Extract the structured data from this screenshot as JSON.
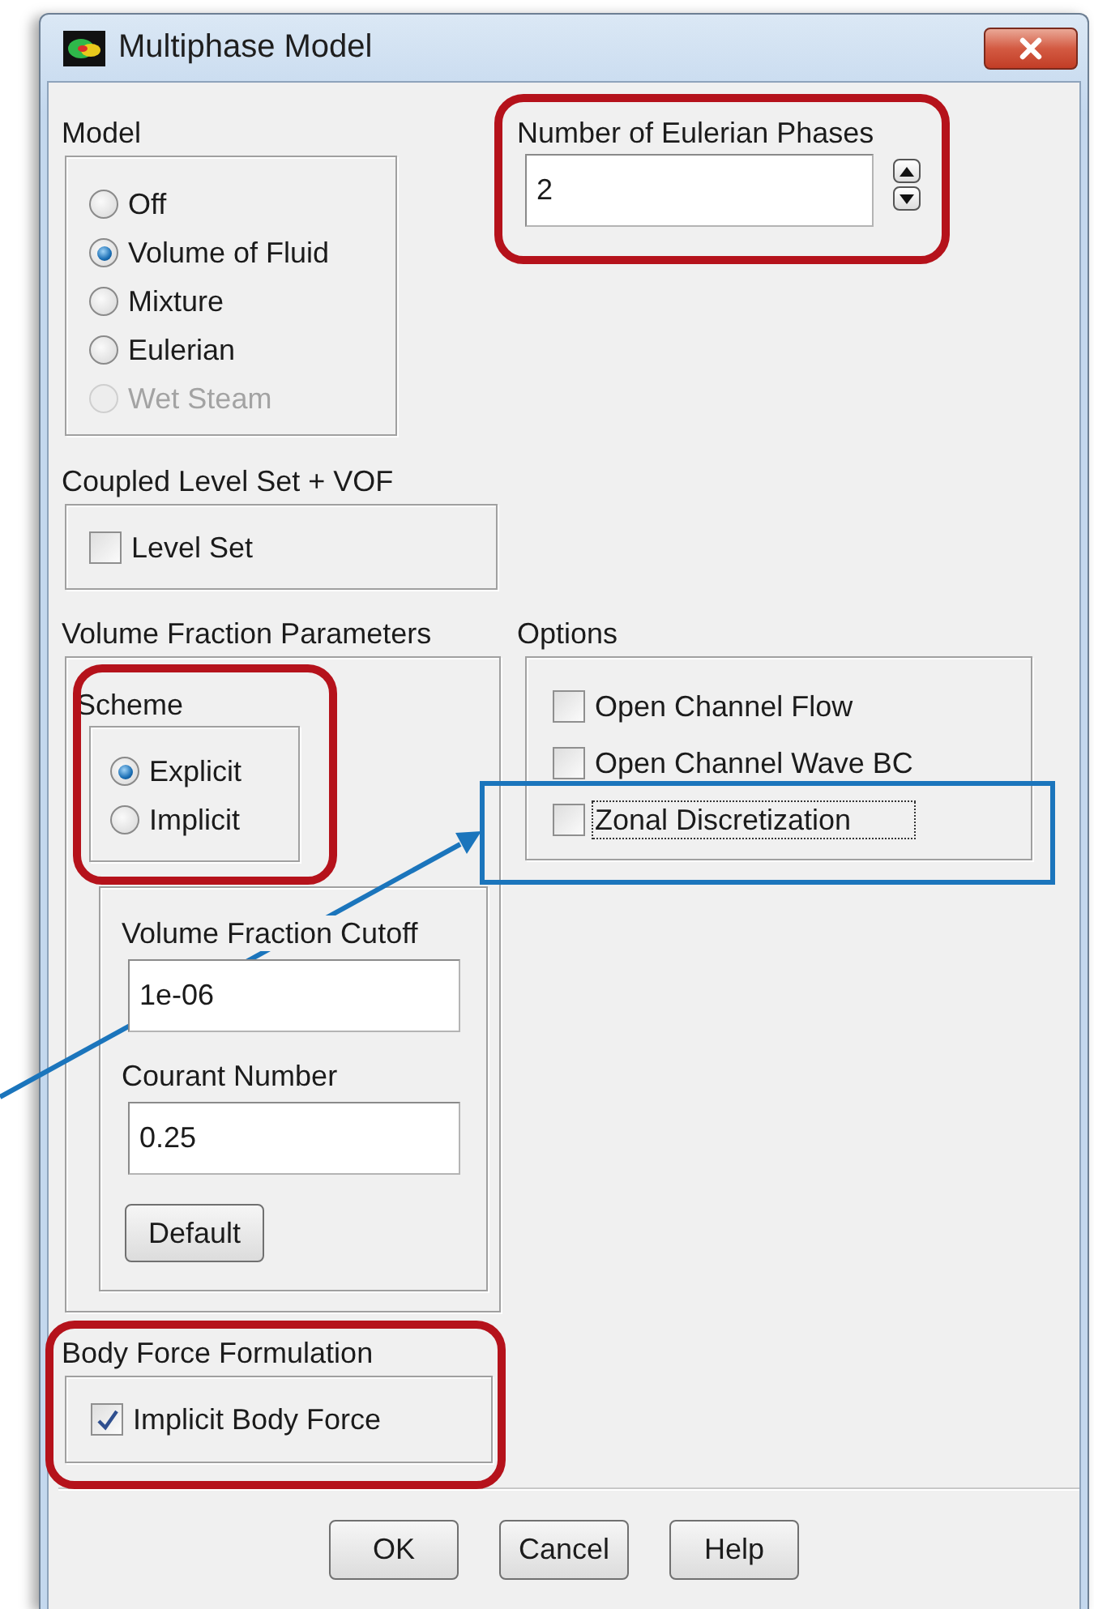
{
  "window": {
    "title": "Multiphase Model"
  },
  "model": {
    "label": "Model",
    "options": [
      {
        "label": "Off",
        "selected": false,
        "disabled": false
      },
      {
        "label": "Volume of Fluid",
        "selected": true,
        "disabled": false
      },
      {
        "label": "Mixture",
        "selected": false,
        "disabled": false
      },
      {
        "label": "Eulerian",
        "selected": false,
        "disabled": false
      },
      {
        "label": "Wet Steam",
        "selected": false,
        "disabled": true
      }
    ]
  },
  "eulerian_phases": {
    "label": "Number of Eulerian Phases",
    "value": "2"
  },
  "coupled_level_set": {
    "label": "Coupled Level Set + VOF",
    "options": [
      {
        "label": "Level Set",
        "checked": false
      }
    ]
  },
  "volume_fraction_parameters": {
    "label": "Volume Fraction Parameters",
    "scheme": {
      "label": "Scheme",
      "options": [
        {
          "label": "Explicit",
          "selected": true,
          "disabled": false
        },
        {
          "label": "Implicit",
          "selected": false,
          "disabled": false
        }
      ]
    },
    "fields": [
      {
        "label": "Volume Fraction Cutoff",
        "value": "1e-06"
      },
      {
        "label": "Courant Number",
        "value": "0.25"
      }
    ],
    "default_button": "Default"
  },
  "options": {
    "label": "Options",
    "items": [
      {
        "label": "Open Channel Flow",
        "checked": false,
        "focused": false
      },
      {
        "label": "Open Channel Wave BC",
        "checked": false,
        "focused": false
      },
      {
        "label": "Zonal Discretization",
        "checked": false,
        "focused": true
      }
    ]
  },
  "body_force_formulation": {
    "label": "Body Force Formulation",
    "options": [
      {
        "label": "Implicit Body Force",
        "checked": true
      }
    ]
  },
  "buttons": [
    "OK",
    "Cancel",
    "Help"
  ]
}
